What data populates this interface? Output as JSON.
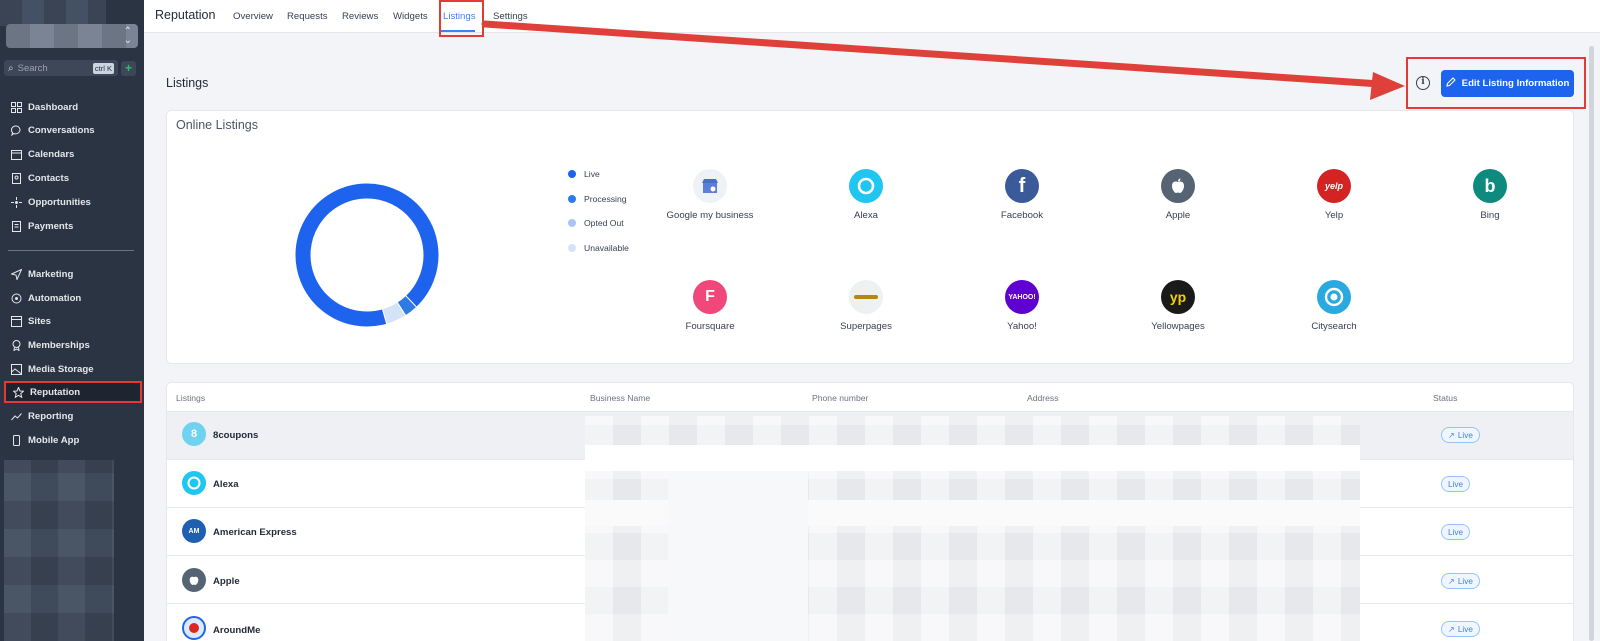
{
  "sidebar": {
    "search_placeholder": "Search",
    "search_shortcut": "ctrl K",
    "items": [
      {
        "label": "Dashboard",
        "icon": "dashboard-icon"
      },
      {
        "label": "Conversations",
        "icon": "chat-icon"
      },
      {
        "label": "Calendars",
        "icon": "calendar-icon"
      },
      {
        "label": "Contacts",
        "icon": "contacts-icon"
      },
      {
        "label": "Opportunities",
        "icon": "opportunities-icon"
      },
      {
        "label": "Payments",
        "icon": "payments-icon"
      },
      {
        "label": "Marketing",
        "icon": "send-icon"
      },
      {
        "label": "Automation",
        "icon": "automation-icon"
      },
      {
        "label": "Sites",
        "icon": "sites-icon"
      },
      {
        "label": "Memberships",
        "icon": "badge-icon"
      },
      {
        "label": "Media Storage",
        "icon": "image-icon"
      },
      {
        "label": "Reputation",
        "icon": "star-icon"
      },
      {
        "label": "Reporting",
        "icon": "trend-icon"
      },
      {
        "label": "Mobile App",
        "icon": "phone-icon"
      }
    ],
    "active_item": "Reputation"
  },
  "topnav": {
    "title": "Reputation",
    "tabs": [
      "Overview",
      "Requests",
      "Reviews",
      "Widgets",
      "Listings",
      "Settings"
    ],
    "active_tab": "Listings"
  },
  "page": {
    "title": "Listings",
    "edit_button_label": "Edit Listing Information"
  },
  "online_listings": {
    "title": "Online Listings",
    "legend": [
      {
        "label": "Live",
        "color": "#1d63ed"
      },
      {
        "label": "Processing",
        "color": "#2f7be5"
      },
      {
        "label": "Opted Out",
        "color": "#a9c5f2"
      },
      {
        "label": "Unavailable",
        "color": "#d5e3f8"
      }
    ],
    "donut_fractions": {
      "live": 0.905,
      "processing": 0.03,
      "opted_out": 0.0,
      "unavailable": 0.045
    },
    "platforms": [
      {
        "name": "Google my business",
        "icon": "google-business-icon",
        "color": "#eef2f7"
      },
      {
        "name": "Alexa",
        "icon": "alexa-icon",
        "color": "#1ec6f0"
      },
      {
        "name": "Facebook",
        "icon": "facebook-icon",
        "color": "#3b5a9a"
      },
      {
        "name": "Apple",
        "icon": "apple-icon",
        "color": "#566372"
      },
      {
        "name": "Yelp",
        "icon": "yelp-icon",
        "color": "#d32323"
      },
      {
        "name": "Bing",
        "icon": "bing-icon",
        "color": "#0f8a7e"
      },
      {
        "name": "Foursquare",
        "icon": "foursquare-icon",
        "color": "#f0487a"
      },
      {
        "name": "Superpages",
        "icon": "superpages-icon",
        "color": "#eef0f2"
      },
      {
        "name": "Yahoo!",
        "icon": "yahoo-icon",
        "color": "#5f01d1"
      },
      {
        "name": "Yellowpages",
        "icon": "yellowpages-icon",
        "color": "#1a1a1a"
      },
      {
        "name": "Citysearch",
        "icon": "citysearch-icon",
        "color": "#2aa8e0"
      }
    ]
  },
  "table": {
    "headers": [
      "Listings",
      "Business Name",
      "Phone number",
      "Address",
      "Status"
    ],
    "rows": [
      {
        "listing": "8coupons",
        "status": "Live",
        "link_icon": true,
        "logo_color": "#6fd3f0",
        "logo_text": "8"
      },
      {
        "listing": "Alexa",
        "status": "Live",
        "link_icon": false,
        "logo_color": "#1ec6f0",
        "logo_text": ""
      },
      {
        "listing": "American Express",
        "status": "Live",
        "link_icon": false,
        "logo_color": "#1f5fb0",
        "logo_text": "AM"
      },
      {
        "listing": "Apple",
        "status": "Live",
        "link_icon": true,
        "logo_color": "#566372",
        "logo_text": ""
      },
      {
        "listing": "AroundMe",
        "status": "Live",
        "link_icon": true,
        "logo_color": "#2563eb",
        "logo_text": ""
      }
    ]
  }
}
